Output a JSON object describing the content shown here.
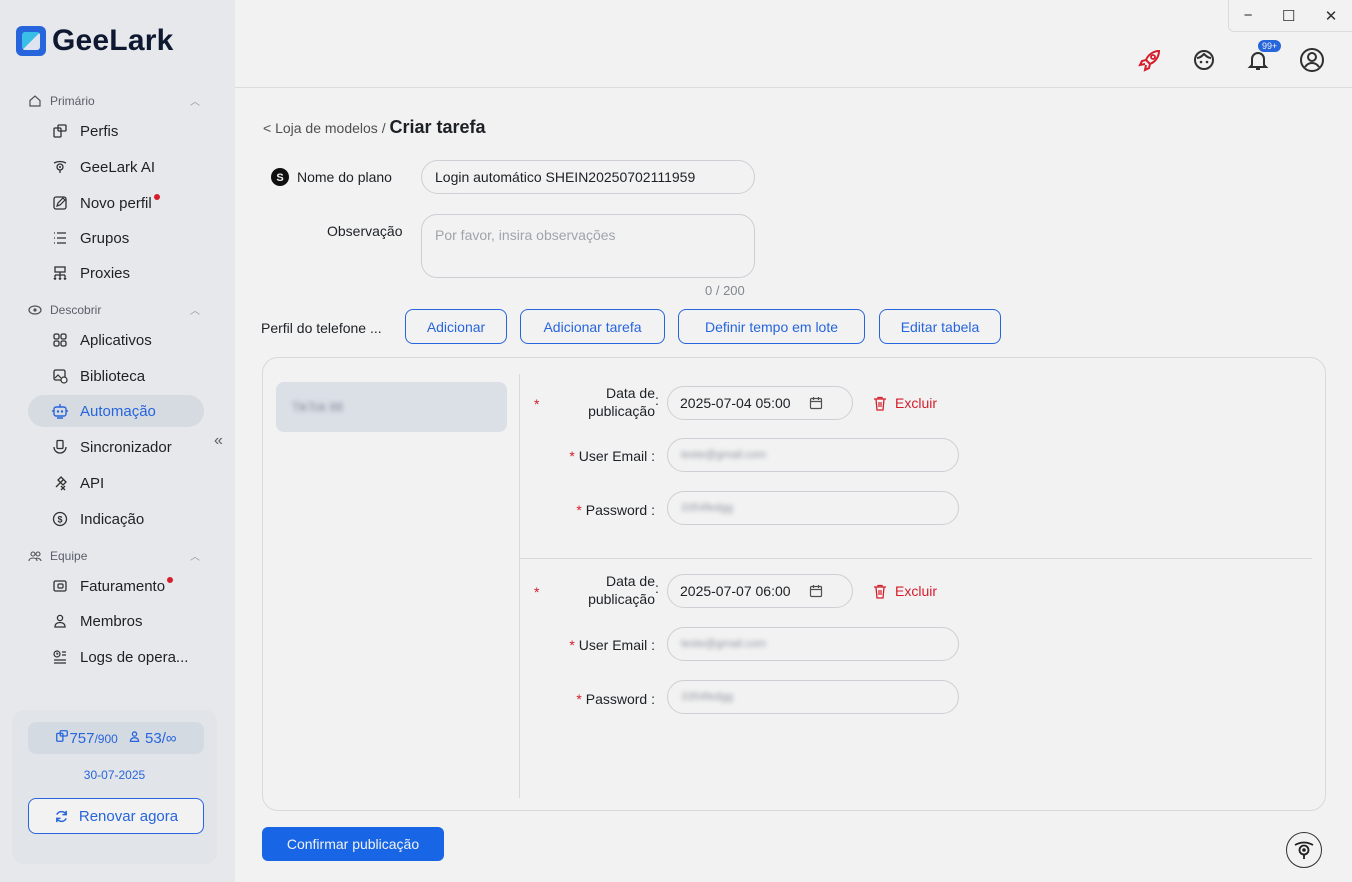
{
  "app": {
    "logo_text": "GeeLark",
    "colors": {
      "accent": "#1a6cf2",
      "danger": "#e0202f",
      "sidebar_bg": "#f3f5f8"
    }
  },
  "sidebar": {
    "sections": [
      {
        "label": "Primário",
        "icon": "home-icon"
      },
      {
        "label": "Descobrir",
        "icon": "discover-icon"
      },
      {
        "label": "Equipe",
        "icon": "team-icon"
      }
    ],
    "items": [
      {
        "label": "Perfis",
        "icon": "profiles-icon"
      },
      {
        "label": "GeeLark AI",
        "icon": "ai-icon"
      },
      {
        "label": "Novo perfil",
        "icon": "edit-icon",
        "dot": true
      },
      {
        "label": "Grupos",
        "icon": "list-icon"
      },
      {
        "label": "Proxies",
        "icon": "proxy-icon"
      },
      {
        "label": "Aplicativos",
        "icon": "apps-icon"
      },
      {
        "label": "Biblioteca",
        "icon": "library-icon"
      },
      {
        "label": "Automação",
        "icon": "robot-icon",
        "active": true
      },
      {
        "label": "Sincronizador",
        "icon": "sync-icon"
      },
      {
        "label": "API",
        "icon": "api-icon"
      },
      {
        "label": "Indicação",
        "icon": "dollar-icon"
      },
      {
        "label": "Faturamento",
        "icon": "wallet-icon",
        "dot": true
      },
      {
        "label": "Membros",
        "icon": "user-icon"
      },
      {
        "label": "Logs de opera...",
        "icon": "logs-icon"
      }
    ],
    "collapse_glyph": "«",
    "plan": {
      "profiles_used": "757",
      "profiles_total": "/900",
      "members_used": "53",
      "members_total": "/∞",
      "expire": "30-07-2025",
      "renew_label": "Renovar agora"
    }
  },
  "topbar": {
    "window": {
      "minimize": "−",
      "maximize": "☐",
      "close": "✕"
    },
    "notif_badge": "99+"
  },
  "main": {
    "breadcrumb": {
      "parent": "< Loja de modelos",
      "sep": " / ",
      "current": "Criar tarefa"
    },
    "plan_name_label": "Nome do plano",
    "plan_name_value": "Login automático SHEIN20250702111959",
    "note_label": "Observação",
    "note_placeholder": "Por favor, insira observações",
    "note_counter": "0 / 200",
    "phone_profile_label": "Perfil do telefone ...",
    "buttons": {
      "add": "Adicionar",
      "add_task": "Adicionar tarefa",
      "batch_time": "Definir tempo em lote",
      "edit_table": "Editar tabela"
    },
    "device_chip": "TikTok 88",
    "tasks": [
      {
        "date_label_1": "Data de",
        "date_label_2": "publicação",
        "date_value": "2025-07-04 05:00",
        "delete_label": "Excluir",
        "email_label": "User Email",
        "email_value": "teste@gmail.com",
        "password_label": "Password",
        "password_value": "3354fedgg"
      },
      {
        "date_label_1": "Data de",
        "date_label_2": "publicação",
        "date_value": "2025-07-07 06:00",
        "delete_label": "Excluir",
        "email_label": "User Email",
        "email_value": "teste@gmail.com",
        "password_label": "Password",
        "password_value": "3354fedgg"
      }
    ],
    "confirm_label": "Confirmar publicação"
  }
}
